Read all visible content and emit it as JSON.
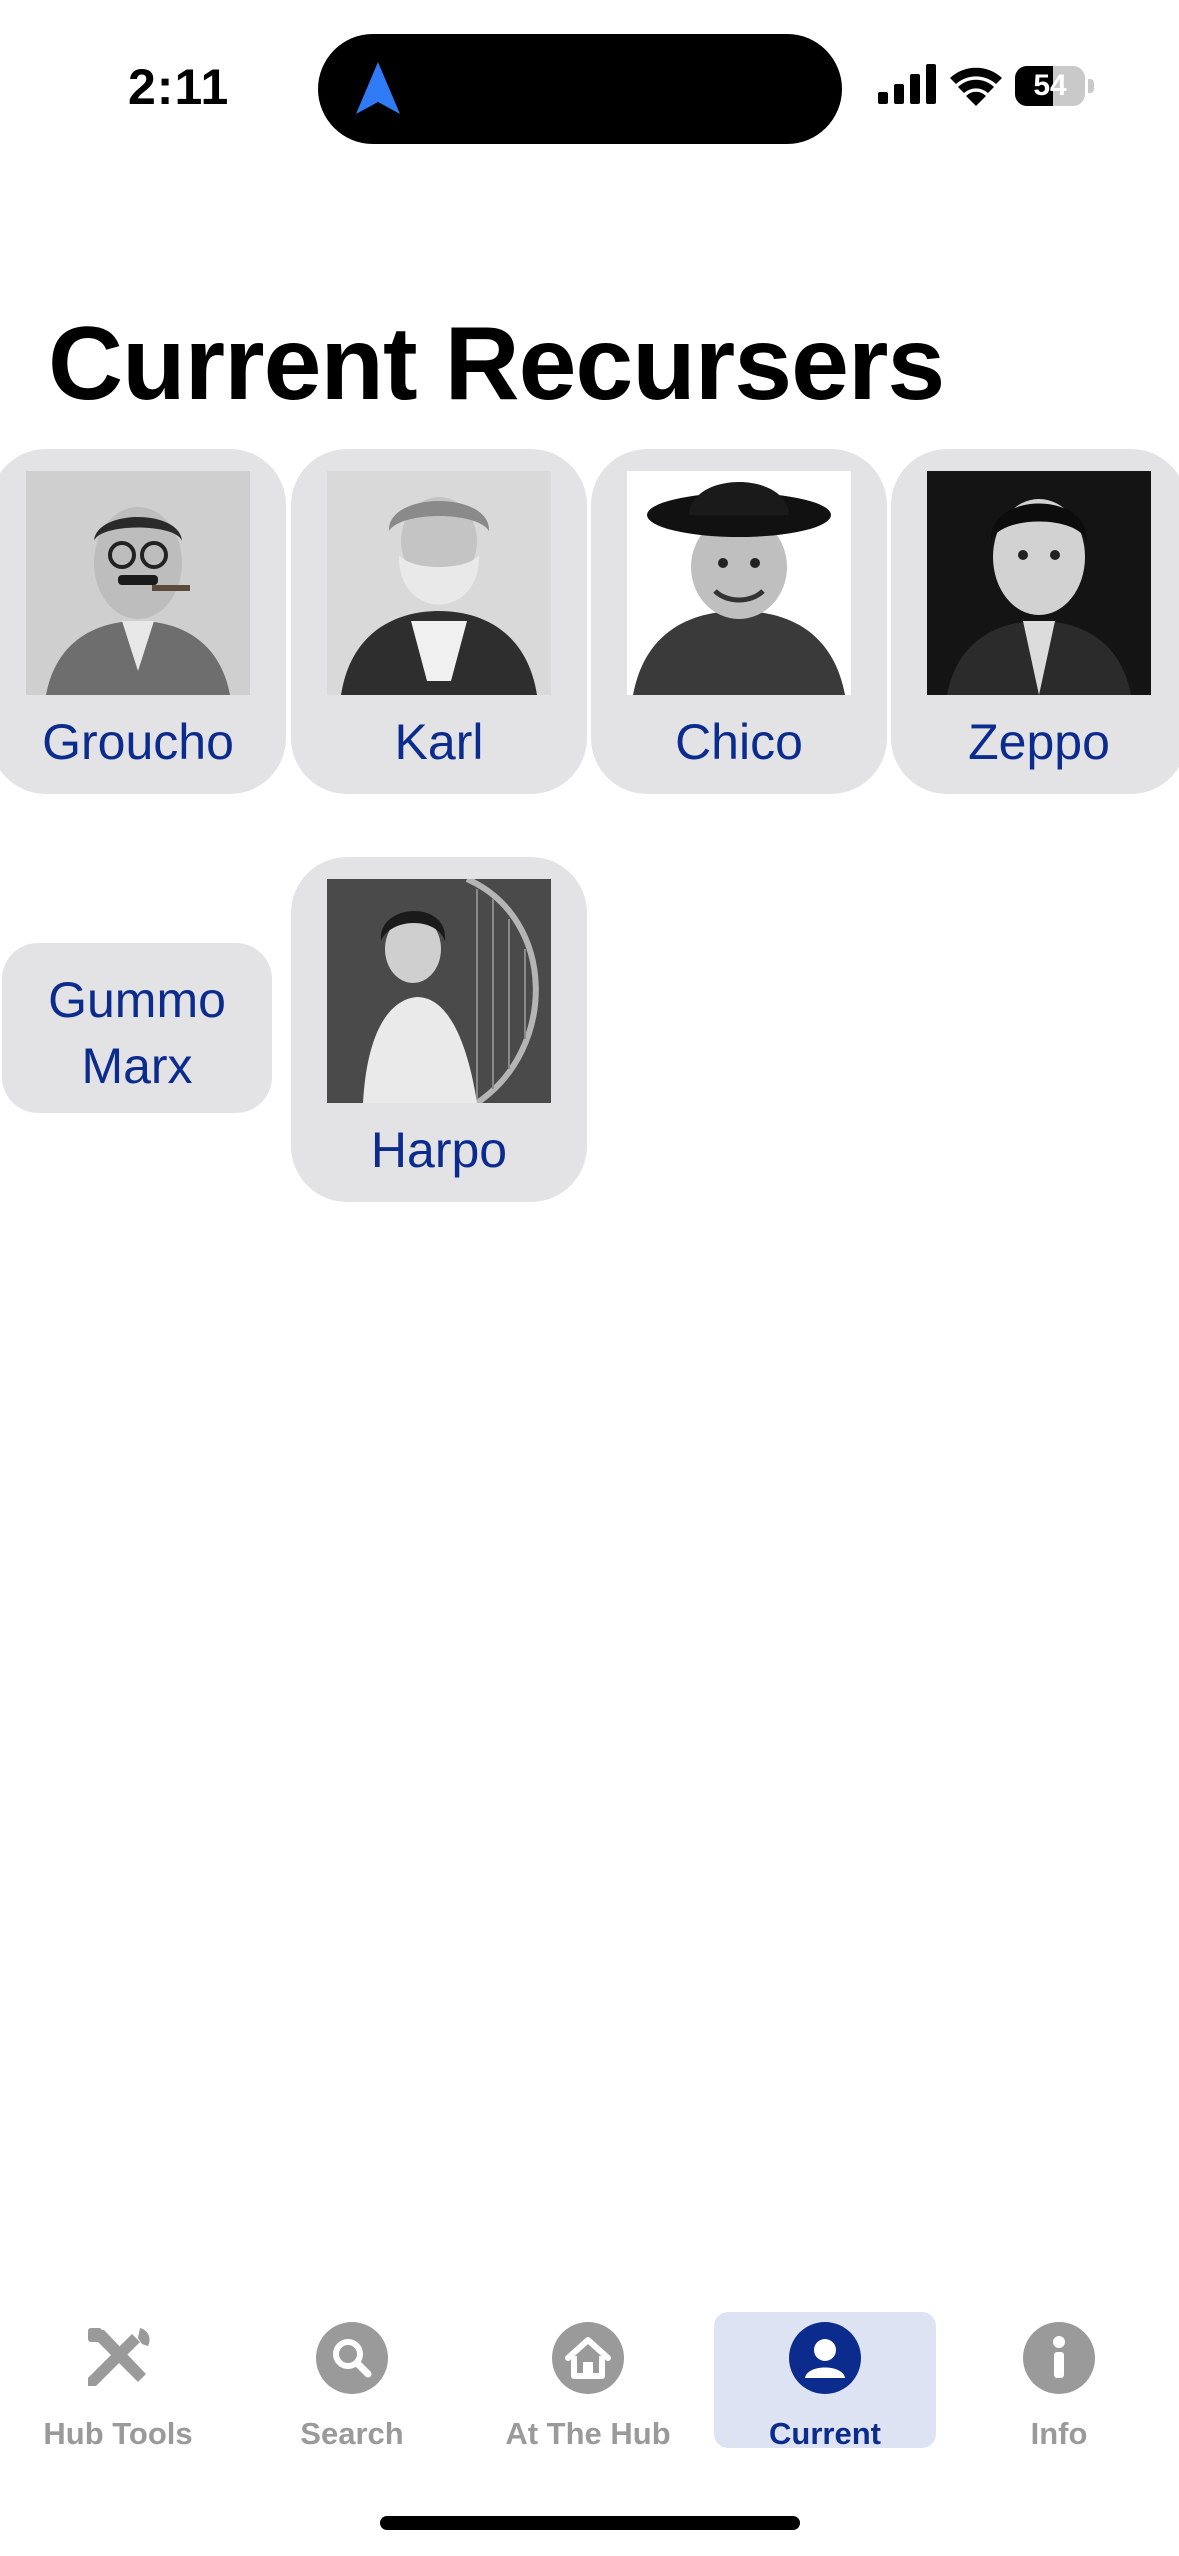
{
  "status_bar": {
    "time": "2:11",
    "battery_percent": "54",
    "battery_level": 0.54,
    "location_arrow_color": "#2f7bf6"
  },
  "page": {
    "title": "Current Recursers"
  },
  "accent_color": "#0b2c8c",
  "recursers": [
    {
      "name": "Groucho",
      "photo": "groucho-portrait"
    },
    {
      "name": "Karl",
      "photo": "karl-portrait"
    },
    {
      "name": "Chico",
      "photo": "chico-portrait"
    },
    {
      "name": "Zeppo",
      "photo": "zeppo-portrait"
    },
    {
      "name": "Gummo Marx",
      "photo": null
    },
    {
      "name": "Harpo",
      "photo": "harpo-portrait"
    }
  ],
  "tab_bar": {
    "tabs": [
      {
        "label": "Hub Tools",
        "icon": "tools-icon",
        "selected": false
      },
      {
        "label": "Search",
        "icon": "search-icon",
        "selected": false
      },
      {
        "label": "At The Hub",
        "icon": "house-icon",
        "selected": false
      },
      {
        "label": "Current",
        "icon": "person-icon",
        "selected": true
      },
      {
        "label": "Info",
        "icon": "info-icon",
        "selected": false
      }
    ]
  }
}
